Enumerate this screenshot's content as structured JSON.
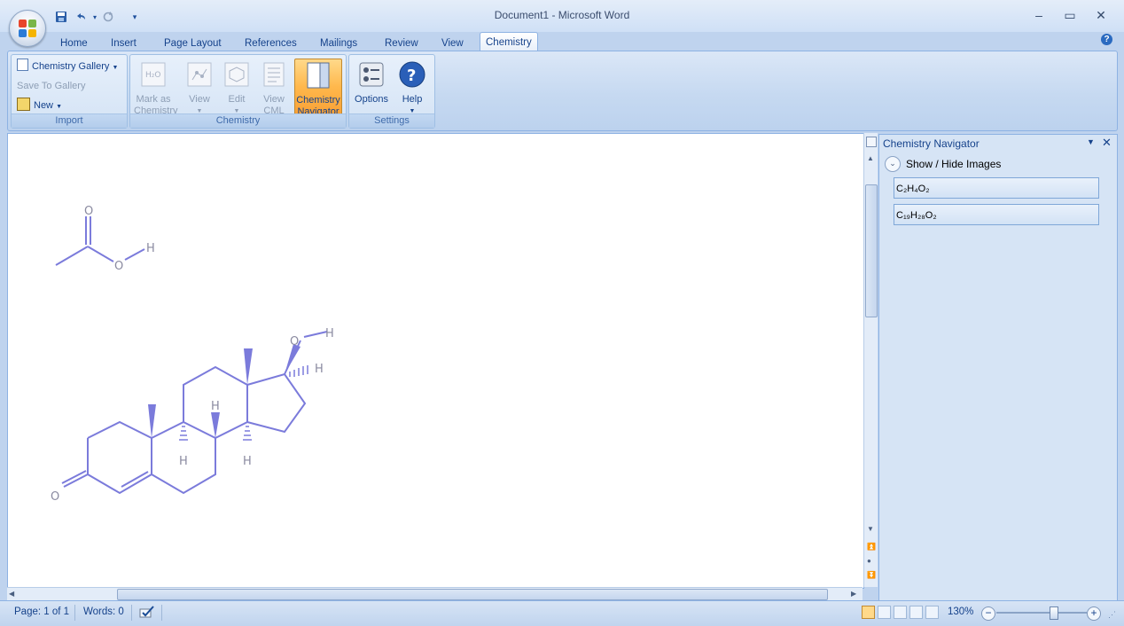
{
  "window": {
    "title": "Document1 - Microsoft Word",
    "minimize": "–",
    "maximize": "▭",
    "close": "✕"
  },
  "qat": {
    "customize": "▾"
  },
  "tabs": [
    "Home",
    "Insert",
    "Page Layout",
    "References",
    "Mailings",
    "Review",
    "View",
    "Chemistry"
  ],
  "active_tab": "Chemistry",
  "ribbon": {
    "import": {
      "label": "Import",
      "gallery": "Chemistry Gallery",
      "save_to_gallery": "Save To Gallery",
      "new": "New"
    },
    "chemistry": {
      "label": "Chemistry",
      "mark_as": [
        "Mark as",
        "Chemistry"
      ],
      "view": "View",
      "edit": "Edit",
      "view_cml": [
        "View",
        "CML"
      ],
      "navigator": [
        "Chemistry",
        "Navigator"
      ]
    },
    "settings": {
      "label": "Settings",
      "options": "Options",
      "help": "Help"
    }
  },
  "document": {
    "acetic_acid": {
      "o_top": "O",
      "o_right": "O",
      "h": "H"
    },
    "steroid": {
      "o_ketone": "O",
      "o_hydroxyl": "O",
      "h_hydroxyl": "H",
      "h_17": "H",
      "h_8": "H",
      "h_9": "H",
      "h_14": "H"
    }
  },
  "navigator": {
    "title": "Chemistry Navigator",
    "show_hide": "Show / Hide Images",
    "items": [
      "C₂H₄O₂",
      "C₁₉H₂₈O₂"
    ]
  },
  "status": {
    "page": "Page: 1 of 1",
    "words": "Words: 0",
    "zoom": "130%",
    "zoom_level": 0.63
  },
  "colors": {
    "molecule": "#7b7bdb",
    "atom_label": "#8a8aa0",
    "ribbon_active": "#ffb84c"
  }
}
